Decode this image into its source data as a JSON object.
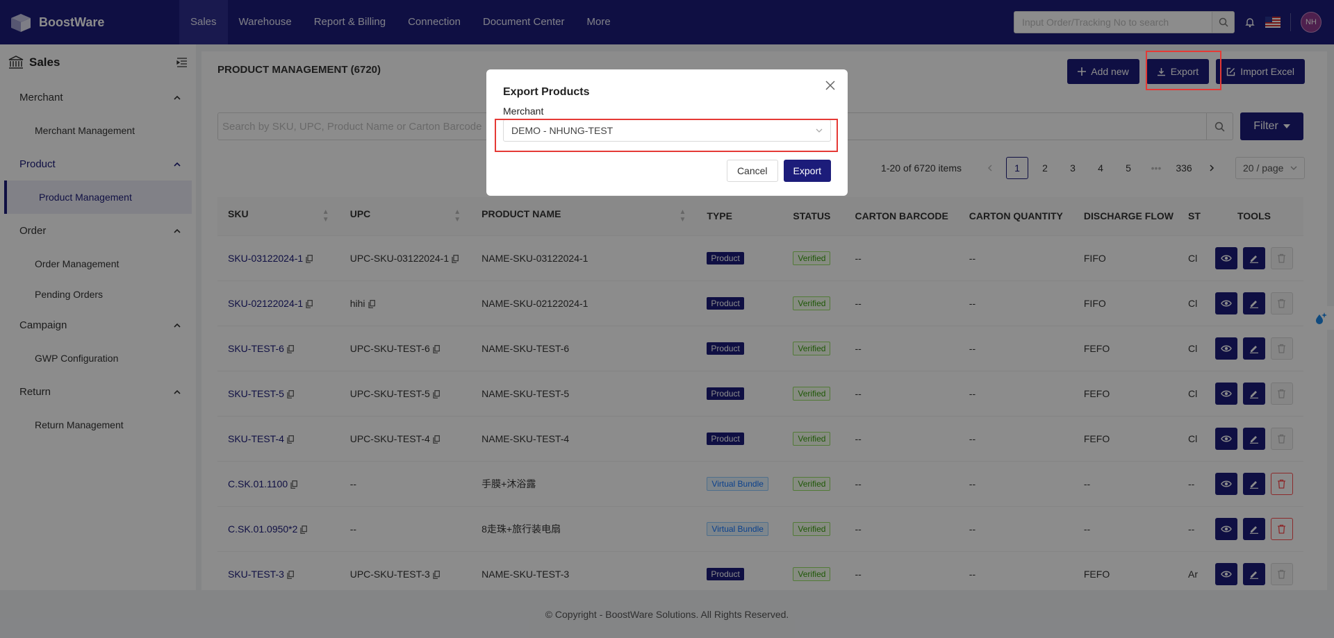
{
  "brand": {
    "name": "BoostWare"
  },
  "nav": {
    "items": [
      "Sales",
      "Warehouse",
      "Report & Billing",
      "Connection",
      "Document Center",
      "More"
    ],
    "active": 0
  },
  "top": {
    "search_placeholder": "Input Order/Tracking No to search",
    "avatar": "NH"
  },
  "sidebar": {
    "title": "Sales",
    "groups": [
      {
        "label": "Merchant",
        "items": [
          "Merchant Management"
        ]
      },
      {
        "label": "Product",
        "items": [
          "Product Management"
        ]
      },
      {
        "label": "Order",
        "items": [
          "Order Management",
          "Pending Orders"
        ]
      },
      {
        "label": "Campaign",
        "items": [
          "GWP Configuration"
        ]
      },
      {
        "label": "Return",
        "items": [
          "Return Management"
        ]
      }
    ],
    "active_item": "Product Management"
  },
  "main": {
    "title": "PRODUCT MANAGEMENT (6720)",
    "add_new": "Add new",
    "export": "Export",
    "import_excel": "Import Excel",
    "search_placeholder": "Search by SKU, UPC, Product Name or Carton Barcode",
    "filter": "Filter"
  },
  "pagination": {
    "total": "1-20 of 6720 items",
    "pages": [
      "1",
      "2",
      "3",
      "4",
      "5",
      "•••",
      "336"
    ],
    "current": "1",
    "page_size": "20 / page"
  },
  "table": {
    "columns": [
      "SKU",
      "UPC",
      "PRODUCT NAME",
      "TYPE",
      "STATUS",
      "CARTON BARCODE",
      "CARTON QUANTITY",
      "DISCHARGE FLOW",
      "ST",
      "TOOLS"
    ],
    "rows": [
      {
        "sku": "SKU-03122024-1",
        "upc": "UPC-SKU-03122024-1",
        "name": "NAME-SKU-03122024-1",
        "type": "Product",
        "status": "Verified",
        "carton_barcode": "--",
        "carton_qty": "--",
        "discharge": "FIFO",
        "st": "Cl"
      },
      {
        "sku": "SKU-02122024-1",
        "upc": "hihi",
        "name": "NAME-SKU-02122024-1",
        "type": "Product",
        "status": "Verified",
        "carton_barcode": "--",
        "carton_qty": "--",
        "discharge": "FIFO",
        "st": "Cl"
      },
      {
        "sku": "SKU-TEST-6",
        "upc": "UPC-SKU-TEST-6",
        "name": "NAME-SKU-TEST-6",
        "type": "Product",
        "status": "Verified",
        "carton_barcode": "--",
        "carton_qty": "--",
        "discharge": "FEFO",
        "st": "Cl"
      },
      {
        "sku": "SKU-TEST-5",
        "upc": "UPC-SKU-TEST-5",
        "name": "NAME-SKU-TEST-5",
        "type": "Product",
        "status": "Verified",
        "carton_barcode": "--",
        "carton_qty": "--",
        "discharge": "FEFO",
        "st": "Cl"
      },
      {
        "sku": "SKU-TEST-4",
        "upc": "UPC-SKU-TEST-4",
        "name": "NAME-SKU-TEST-4",
        "type": "Product",
        "status": "Verified",
        "carton_barcode": "--",
        "carton_qty": "--",
        "discharge": "FEFO",
        "st": "Cl"
      },
      {
        "sku": "C.SK.01.1100",
        "upc": "--",
        "name": "手膜+沐浴露",
        "type": "Virtual Bundle",
        "status": "Verified",
        "carton_barcode": "--",
        "carton_qty": "--",
        "discharge": "--",
        "st": "--"
      },
      {
        "sku": "C.SK.01.0950*2",
        "upc": "--",
        "name": "8走珠+旅行装电扇",
        "type": "Virtual Bundle",
        "status": "Verified",
        "carton_barcode": "--",
        "carton_qty": "--",
        "discharge": "--",
        "st": "--"
      },
      {
        "sku": "SKU-TEST-3",
        "upc": "UPC-SKU-TEST-3",
        "name": "NAME-SKU-TEST-3",
        "type": "Product",
        "status": "Verified",
        "carton_barcode": "--",
        "carton_qty": "--",
        "discharge": "FEFO",
        "st": "Ar"
      }
    ]
  },
  "footer": "© Copyright - BoostWare Solutions. All Rights Reserved.",
  "modal": {
    "title": "Export Products",
    "field_label": "Merchant",
    "selected": "DEMO - NHUNG-TEST",
    "cancel": "Cancel",
    "confirm": "Export"
  },
  "colors": {
    "primary": "#1c1c7a",
    "highlight": "#e53935",
    "verified": "#389e0d",
    "danger": "#ff4d4f"
  }
}
